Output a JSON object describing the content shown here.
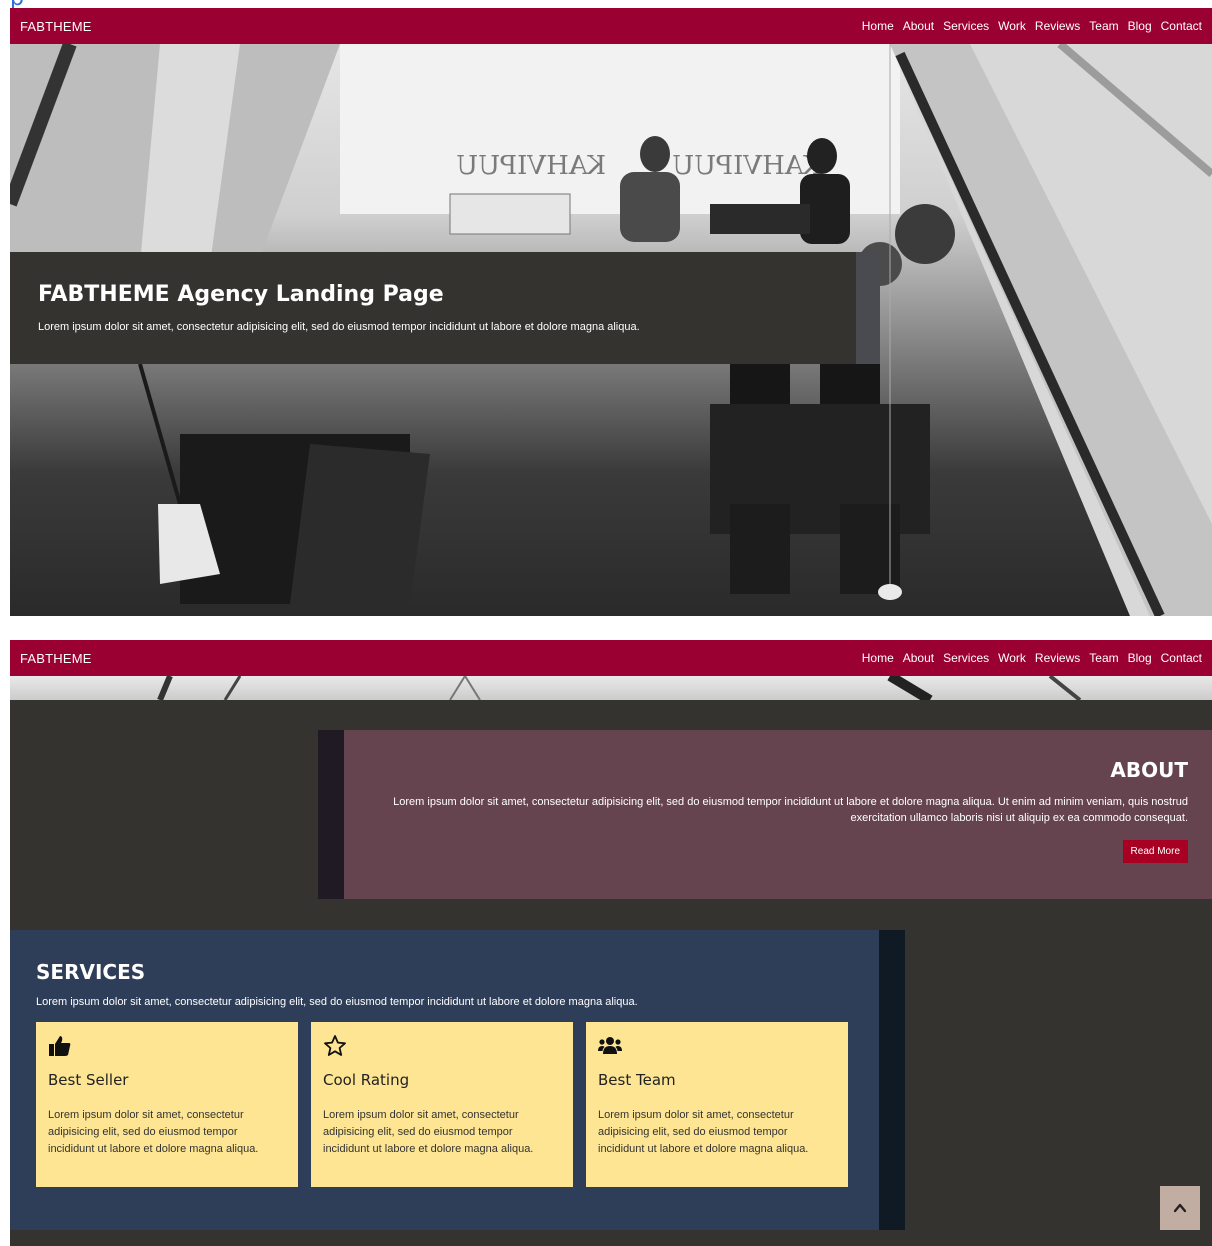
{
  "nav": {
    "brand": "FABTHEME",
    "items": [
      "Home",
      "About",
      "Services",
      "Work",
      "Reviews",
      "Team",
      "Blog",
      "Contact"
    ]
  },
  "hero": {
    "title": "FABTHEME Agency Landing Page",
    "text": "Lorem ipsum dolor sit amet, consectetur adipisicing elit, sed do eiusmod tempor incididunt ut labore et dolore magna aliqua.",
    "window_sign_left": "KAHVIPUU",
    "window_sign_right": "KAHVIPUU"
  },
  "about": {
    "title": "ABOUT",
    "text": "Lorem ipsum dolor sit amet, consectetur adipisicing elit, sed do eiusmod tempor incididunt ut labore et dolore magna aliqua. Ut enim ad minim veniam, quis nostrud exercitation ullamco laboris nisi ut aliquip ex ea commodo consequat.",
    "button": "Read More"
  },
  "services": {
    "title": "SERVICES",
    "text": "Lorem ipsum dolor sit amet, consectetur adipisicing elit, sed do eiusmod tempor incididunt ut labore et dolore magna aliqua.",
    "cards": [
      {
        "icon": "thumbs-up-icon",
        "title": "Best Seller",
        "text": "Lorem ipsum dolor sit amet, consectetur adipisicing elit, sed do eiusmod tempor incididunt ut labore et dolore magna aliqua."
      },
      {
        "icon": "star-outline-icon",
        "title": "Cool Rating",
        "text": "Lorem ipsum dolor sit amet, consectetur adipisicing elit, sed do eiusmod tempor incididunt ut labore et dolore magna aliqua."
      },
      {
        "icon": "users-icon",
        "title": "Best Team",
        "text": "Lorem ipsum dolor sit amet, consectetur adipisicing elit, sed do eiusmod tempor incididunt ut labore et dolore magna aliqua."
      }
    ]
  },
  "colors": {
    "nav_bg": "#9b0032",
    "hero_box": "#353330",
    "about_bg": "#66444f",
    "services_bg": "#2e3d58",
    "card_bg": "#fde593",
    "button_bg": "#a80022"
  },
  "scroll_top_icon": "chevron-up-icon"
}
